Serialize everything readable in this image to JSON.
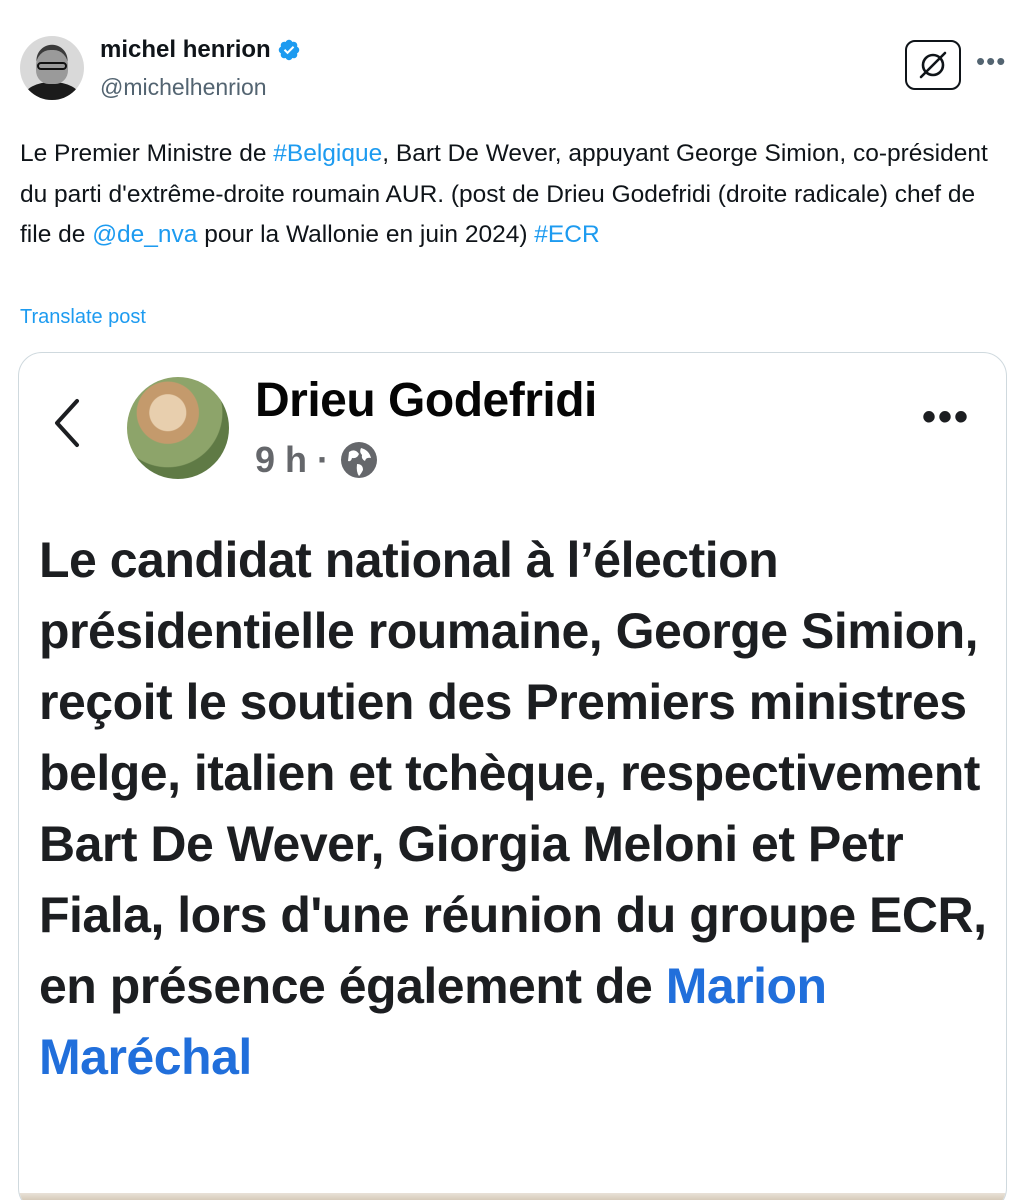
{
  "author": {
    "display_name": "michel henrion",
    "handle": "@michelhenrion"
  },
  "post": {
    "segments": [
      {
        "text": "Le Premier Ministre de ",
        "link": false
      },
      {
        "text": "#Belgique",
        "link": true
      },
      {
        "text": ", Bart De Wever, appuyant George Simion, co-président du parti d'extrême-droite roumain AUR. (post de Drieu Godefridi (droite radicale) chef de file de ",
        "link": false
      },
      {
        "text": "@de_nva",
        "link": true
      },
      {
        "text": " pour la Wallonie en juin 2024) ",
        "link": false
      },
      {
        "text": "#ECR",
        "link": true
      }
    ],
    "translate_label": "Translate post"
  },
  "embedded": {
    "author": "Drieu Godefridi",
    "time": "9 h ·",
    "text_main": "Le candidat national à l’élection présidentielle roumaine, George Simion, reçoit le soutien des Premiers ministres belge, italien et tchèque, respectivement Bart De Wever, Giorgia Meloni et Petr Fiala, lors d'une réunion du groupe ECR, en présence également de",
    "text_mention": "Marion Maréchal"
  },
  "icons": {
    "verified": "verified-badge-icon",
    "grok": "grok-icon",
    "more": "more-icon",
    "back": "chevron-left-icon",
    "globe": "globe-icon"
  },
  "colors": {
    "link": "#1d9bf0",
    "verified": "#1d9bf0",
    "mention": "#216fdb",
    "secondary": "#536471"
  }
}
